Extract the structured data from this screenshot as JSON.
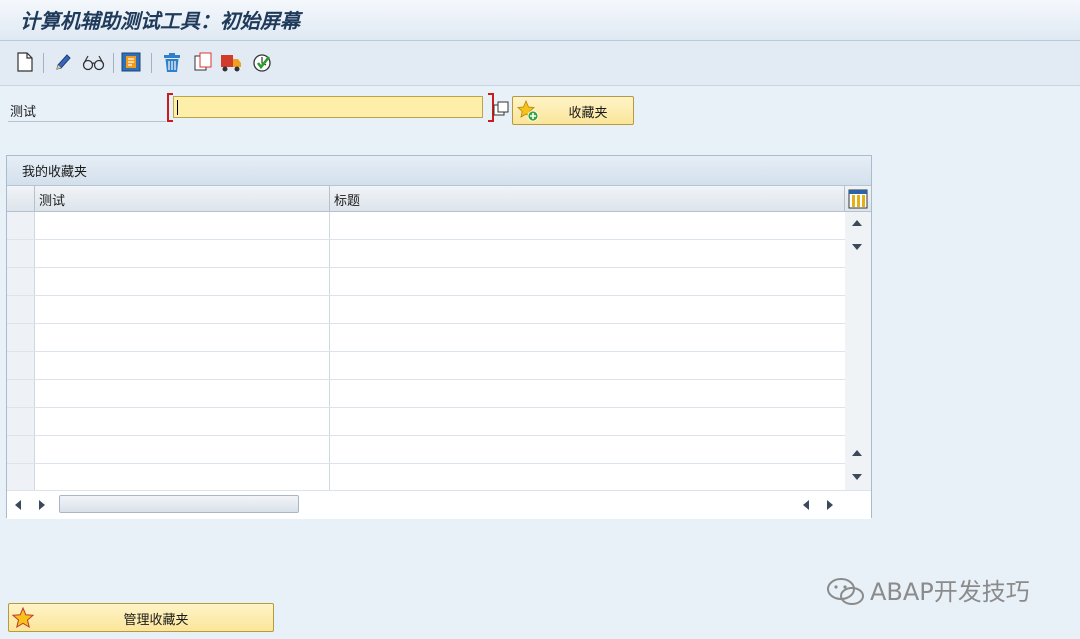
{
  "title": "计算机辅助测试工具：初始屏幕",
  "toolbar": {
    "icons": [
      "new-document-icon",
      "edit-pencil-icon",
      "display-glasses-icon",
      "transport-icon",
      "delete-icon",
      "copy-icon",
      "truck-icon",
      "execute-check-icon"
    ]
  },
  "form": {
    "test_label": "测试",
    "test_value": "",
    "favorites_button": "收藏夹"
  },
  "favorites_table": {
    "title": "我的收藏夹",
    "columns": [
      "测试",
      "标题"
    ],
    "row_count": 10
  },
  "manage_button": "管理收藏夹",
  "watermark": "ABAP开发技巧",
  "colors": {
    "input_bg": "#fdeea9",
    "button_bg": "#fbe59a",
    "required_marker": "#cc1b1b",
    "background": "#e9f1f8"
  }
}
